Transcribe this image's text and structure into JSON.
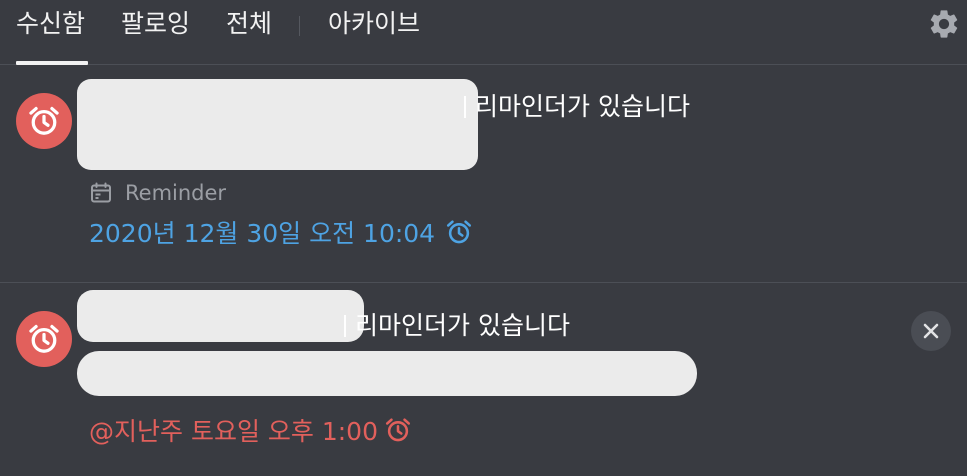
{
  "tabs": [
    {
      "label": "수신함",
      "active": true
    },
    {
      "label": "팔로잉",
      "active": false
    },
    {
      "label": "전체",
      "active": false
    },
    {
      "label": "아카이브",
      "active": false
    }
  ],
  "header": {
    "settings_icon": "gear-icon"
  },
  "notifications": [
    {
      "icon": "alarm-clock-icon",
      "message_suffix": "리마인더가 있습니다",
      "category_icon": "calendar-icon",
      "category_label": "Reminder",
      "time": "2020년 12월 30일 오전 10:04",
      "time_icon": "alarm-clock-icon",
      "time_color": "#4ea3e3"
    },
    {
      "icon": "alarm-clock-icon",
      "message_suffix": "리마인더가 있습니다",
      "time": "@지난주 토요일 오후 1:00",
      "time_icon": "alarm-clock-icon",
      "time_color": "#e2605c",
      "dismiss_icon": "close-icon"
    }
  ],
  "colors": {
    "background": "#393b41",
    "avatar": "#e2605c",
    "link_blue": "#4ea3e3",
    "overdue_red": "#e2605c",
    "muted_text": "#9b9ea4"
  }
}
